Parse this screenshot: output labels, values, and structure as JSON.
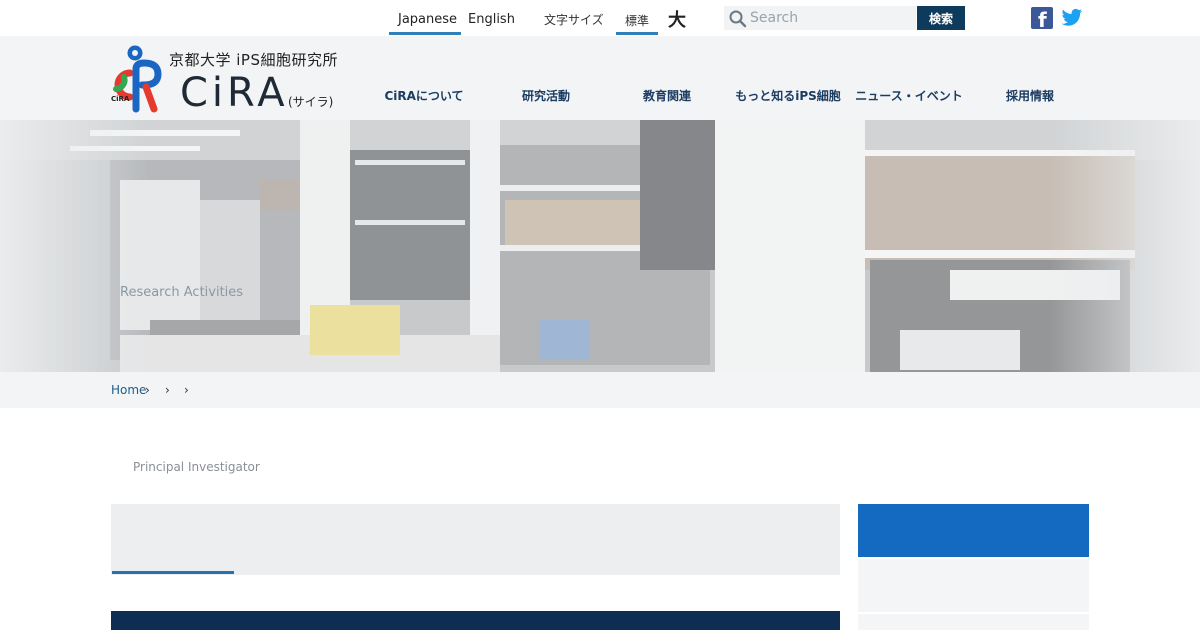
{
  "topbar": {
    "lang_ja": "Japanese",
    "lang_en": "English",
    "font_size_label": "文字サイズ",
    "font_size_standard": "標準",
    "font_size_large": "大",
    "search_placeholder": "Search",
    "search_button": "検索",
    "social": [
      "facebook-icon",
      "twitter-icon"
    ]
  },
  "header": {
    "logo_small": "CiRA",
    "logo_university": "京都大学 iPS細胞研究所",
    "logo_name": "CiRA",
    "logo_kana": "(サイラ)"
  },
  "nav": [
    {
      "label": "CiRAについて"
    },
    {
      "label": "研究活動"
    },
    {
      "label": "教育関連"
    },
    {
      "label": "もっと知るiPS細胞"
    },
    {
      "label": "ニュース・イベント"
    },
    {
      "label": "採用情報"
    }
  ],
  "hero": {
    "title": "Research Activities"
  },
  "breadcrumb": {
    "home": "Home",
    "separator": "›"
  },
  "main": {
    "section_label": "Principal Investigator"
  },
  "colors": {
    "accent_blue": "#1469c0",
    "navy": "#0e3a5c",
    "dark_panel": "#0e2d52",
    "facebook": "#3b5998",
    "twitter": "#1da1f2"
  }
}
